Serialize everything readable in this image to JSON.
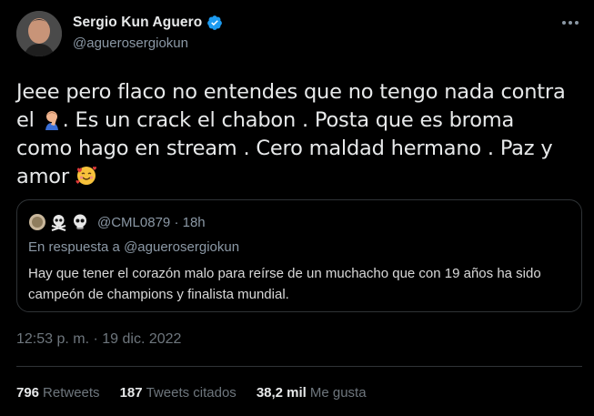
{
  "author": {
    "display_name": "Sergio Kun Aguero",
    "handle": "@aguerosergiokun",
    "verified": true
  },
  "tweet": {
    "text_part1": "Jeee pero flaco no entendes que no tengo nada contra el ",
    "text_part2": ". Es un crack el chabon . Posta que es broma como hago en stream . Cero maldad hermano . Paz y amor ",
    "emoji_1": "man-facepalming-emoji",
    "emoji_2": "smiling-face-with-hearts-emoji"
  },
  "quote": {
    "handle": "@CML0879",
    "age": "18h",
    "reply_prefix": "En respuesta a ",
    "reply_to": "@aguerosergiokun",
    "body": "Hay que tener el corazón malo para reírse de un muchacho que con 19 años ha sido campeón de champions y finalista mundial."
  },
  "timestamp": "12:53 p. m. · 19 dic. 2022",
  "stats": {
    "retweets_count": "796",
    "retweets_label": "Retweets",
    "quotes_count": "187",
    "quotes_label": "Tweets citados",
    "likes_count": "38,2 mil",
    "likes_label": "Me gusta"
  },
  "colors": {
    "background": "#000000",
    "verified_blue": "#1d9bf0",
    "secondary_text": "#8b98a5",
    "border": "#2f3336"
  }
}
